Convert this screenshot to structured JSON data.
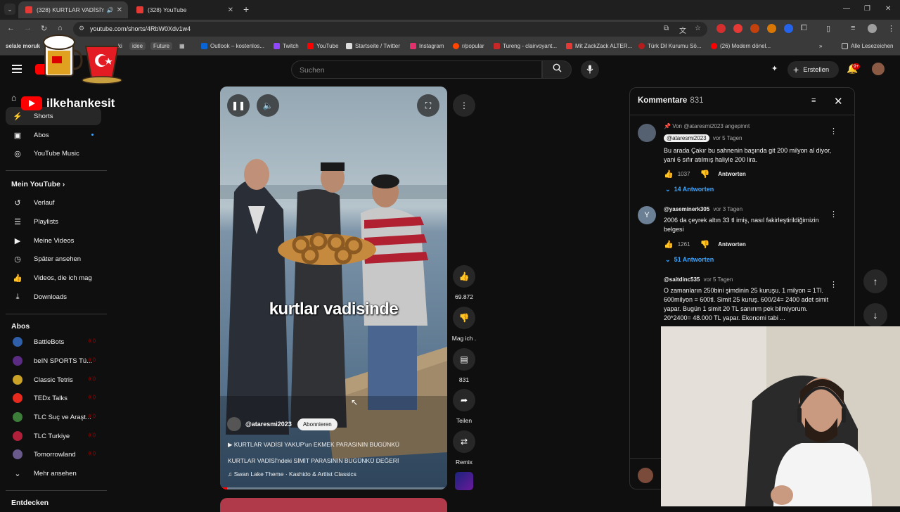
{
  "browser": {
    "tabs": [
      {
        "title": "(328) KURTLAR VADİSİ'ndeki",
        "active": true
      },
      {
        "title": "(328) YouTube",
        "active": false
      }
    ],
    "url": "youtube.com/shorts/4RbW0Xdv1w4",
    "bookmarks": [
      "selale moruk",
      "ki",
      "idee",
      "Future",
      "Outlook – kostenlos...",
      "Twitch",
      "YouTube",
      "Startseite / Twitter",
      "Instagram",
      "r/popular",
      "Tureng - clairvoyant...",
      "Mit ZackZack ALTER...",
      "Türk Dil Kurumu Sö...",
      "(26) Modern dönel...",
      "Alle Lesezeichen"
    ]
  },
  "header": {
    "search_placeholder": "Suchen",
    "create_label": "Erstellen",
    "notif_badge": "9+"
  },
  "overlay": {
    "channel_name": "ilkehankesit"
  },
  "sidebar": {
    "main": [
      {
        "label": "Shorts",
        "icon": "shorts-icon"
      },
      {
        "label": "Abos",
        "icon": "subscriptions-icon"
      },
      {
        "label": "YouTube Music",
        "icon": "music-icon"
      }
    ],
    "you_heading": "Mein YouTube",
    "you": [
      {
        "label": "Verlauf",
        "icon": "history-icon"
      },
      {
        "label": "Playlists",
        "icon": "playlists-icon"
      },
      {
        "label": "Meine Videos",
        "icon": "my-videos-icon"
      },
      {
        "label": "Später ansehen",
        "icon": "watch-later-icon"
      },
      {
        "label": "Videos, die ich mag",
        "icon": "liked-icon"
      },
      {
        "label": "Downloads",
        "icon": "download-icon"
      }
    ],
    "subs_heading": "Abos",
    "subs": [
      {
        "label": "BattleBots",
        "color": "#2e5fa8"
      },
      {
        "label": "beIN SPORTS Tü...",
        "color": "#5b2c83"
      },
      {
        "label": "Classic Tetris",
        "color": "#c9a227"
      },
      {
        "label": "TEDx Talks",
        "color": "#e62b1e"
      },
      {
        "label": "TLC Suç ve Araşt...",
        "color": "#3c7d3a"
      },
      {
        "label": "TLC Turkiye",
        "color": "#b0203a"
      },
      {
        "label": "Tomorrowland",
        "color": "#6a5a8c"
      }
    ],
    "more_label": "Mehr ansehen",
    "explore_heading": "Entdecken"
  },
  "short": {
    "caption": "kurtlar vadisinde",
    "channel": "@ataresmi2023",
    "subscribe_label": "Abonnieren",
    "title_line": "KURTLAR VADİSİ YAKUP'un EKMEK PARASININ BUGÜNKÜ",
    "desc_line": "KURTLAR VADİSİ'ndeki SİMİT PARASININ BUGÜNKÜ DEĞERİ",
    "music_line": "Swan Lake Theme · Kashido & Artlist Classics",
    "progress": 0.03
  },
  "actions": {
    "likes": "69.872",
    "dislike_label": "Mag ich .",
    "comments": "831",
    "share_label": "Teilen",
    "remix_label": "Remix"
  },
  "comments": {
    "title": "Kommentare",
    "count": "831",
    "items": [
      {
        "pinned": "Von @ataresmi2023 angepinnt",
        "handle": "@ataresmi2023",
        "time": "vor 5 Tagen",
        "text": "Bu arada Çakır bu sahnenin başında git 200 milyon al diyor, yani 6 sıfır atılmış haliyle 200 lira.",
        "likes": "1037",
        "reply_label": "Antworten",
        "replies": "14 Antworten"
      },
      {
        "handle": "@yaseminerk305",
        "time": "vor 3 Tagen",
        "avatar_letter": "Y",
        "text": "2006 da çeyrek altın 33 tl imiş, nasıl fakirleştirildiğimizin belgesi",
        "likes": "1261",
        "reply_label": "Antworten",
        "replies": "51 Antworten"
      },
      {
        "handle": "@saitdinc535",
        "time": "vor 5 Tagen",
        "text": "O zamanların 250bini şimdinin 25 kuruşu. 1 milyon = 1Tl. 600milyon = 600tl. Simit 25 kuruş. 600/24= 2400 adet simit yapar. Bugün 1 simit 20 TL sanırım pek bilmiyorum. 20*2400= 48.000 TL yapar. Ekonomi tabi ..."
      }
    ]
  }
}
